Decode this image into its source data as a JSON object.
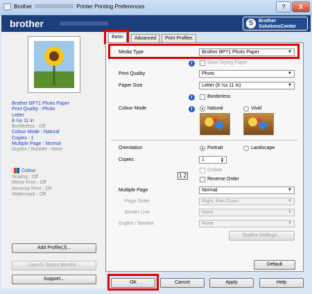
{
  "window": {
    "title_prefix": "Brother",
    "title_suffix": "Printer Printing Preferences",
    "btn_help": "?",
    "btn_close": "X"
  },
  "banner": {
    "logo": "brother",
    "solutions_line1": "Brother",
    "solutions_line2": "SolutionsCenter",
    "solutions_icon": "S"
  },
  "tabs": [
    "Basic",
    "Advanced",
    "Print Profiles"
  ],
  "left_summary": [
    "Brother BP71 Photo Paper",
    "Print Quality : Photo",
    "Letter",
    "8 ½x 11 in",
    "Borderless : Off",
    "Colour Mode : Natural",
    "Copies : 1",
    "Multiple Page : Normal",
    "Duplex / Booklet : None"
  ],
  "left_summary2": [
    "Colour",
    "Scaling : Off",
    "Mirror Print : Off",
    "Reverse Print : Off",
    "Watermark : Off"
  ],
  "left_buttons": {
    "add_profile": "Add Profile(J)...",
    "launch_monitor": "Launch Status Monitor...",
    "support": "Support..."
  },
  "basic": {
    "media_type_label": "Media Type",
    "media_type_value": "Brother BP71 Photo Paper",
    "slow_drying": "Slow Drying Paper",
    "print_quality_label": "Print Quality",
    "print_quality_value": "Photo",
    "paper_size_label": "Paper Size",
    "paper_size_value": "Letter (8 ½x 11 in)",
    "borderless": "Borderless",
    "colour_mode_label": "Colour Mode",
    "natural": "Natural",
    "vivid": "Vivid",
    "orientation_label": "Orientation",
    "portrait": "Portrait",
    "landscape": "Landscape",
    "copies_label": "Copies",
    "copies_value": "1",
    "collate": "Collate",
    "reverse_order": "Reverse Order",
    "collate_icon": "1 2",
    "multiple_page_label": "Multiple Page",
    "multiple_page_value": "Normal",
    "page_order_label": "Page Order",
    "page_order_value": "Right, then Down",
    "border_line_label": "Border Line",
    "border_line_value": "None",
    "duplex_label": "Duplex / Booklet",
    "duplex_value": "None",
    "duplex_settings": "Duplex Settings...",
    "default": "Default"
  },
  "bottom": {
    "ok": "OK",
    "cancel": "Cancel",
    "apply": "Apply",
    "help": "Help"
  }
}
